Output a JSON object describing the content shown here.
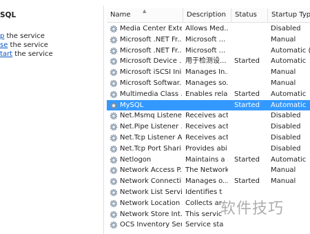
{
  "left_panel": {
    "title": "SQL",
    "actions": [
      {
        "link": "p",
        "text": " the service"
      },
      {
        "link": "se",
        "text": " the service"
      },
      {
        "link": "tart",
        "text": " the service"
      }
    ]
  },
  "columns": [
    "Name",
    "Description",
    "Status",
    "Startup Type"
  ],
  "rows": [
    {
      "name": "Media Center Exte...",
      "description": "Allows Med...",
      "status": "",
      "startup": "Disabled"
    },
    {
      "name": "Microsoft .NET Fr...",
      "description": "Microsoft ...",
      "status": "",
      "startup": "Manual"
    },
    {
      "name": "Microsoft .NET Fr...",
      "description": "Microsoft ...",
      "status": "",
      "startup": "Automatic (D"
    },
    {
      "name": "Microsoft Device ...",
      "description": "用于检测设...",
      "status": "Started",
      "startup": "Automatic"
    },
    {
      "name": "Microsoft iSCSI Ini...",
      "description": "Manages In...",
      "status": "",
      "startup": "Manual"
    },
    {
      "name": "Microsoft Softwar...",
      "description": "Manages so...",
      "status": "",
      "startup": "Manual"
    },
    {
      "name": "Multimedia Class ...",
      "description": "Enables rela...",
      "status": "Started",
      "startup": "Automatic"
    },
    {
      "name": "MySQL",
      "description": "",
      "status": "Started",
      "startup": "Automatic",
      "selected": true
    },
    {
      "name": "Net.Msmq Listene...",
      "description": "Receives act...",
      "status": "",
      "startup": "Disabled"
    },
    {
      "name": "Net.Pipe Listener ...",
      "description": "Receives act...",
      "status": "",
      "startup": "Disabled"
    },
    {
      "name": "Net.Tcp Listener A...",
      "description": "Receives act...",
      "status": "",
      "startup": "Disabled"
    },
    {
      "name": "Net.Tcp Port Shari...",
      "description": "Provides abi...",
      "status": "",
      "startup": "Disabled"
    },
    {
      "name": "Netlogon",
      "description": "Maintains a ...",
      "status": "Started",
      "startup": "Automatic"
    },
    {
      "name": "Network Access P...",
      "description": "The Network...",
      "status": "",
      "startup": "Manual"
    },
    {
      "name": "Network Connecti...",
      "description": "Manages o...",
      "status": "Started",
      "startup": "Manual"
    },
    {
      "name": "Network List Service",
      "description": "Identifies t",
      "status": "",
      "startup": ""
    },
    {
      "name": "Network Location ...",
      "description": "Collects ar",
      "status": "",
      "startup": ""
    },
    {
      "name": "Network Store Int...",
      "description": "This servic",
      "status": "",
      "startup": ""
    },
    {
      "name": "OCS Inventory Ser...",
      "description": "Service sta",
      "status": "",
      "startup": ""
    }
  ],
  "watermark": "软件技巧",
  "colors": {
    "selection": "#3399ff",
    "link": "#0b54c2"
  }
}
